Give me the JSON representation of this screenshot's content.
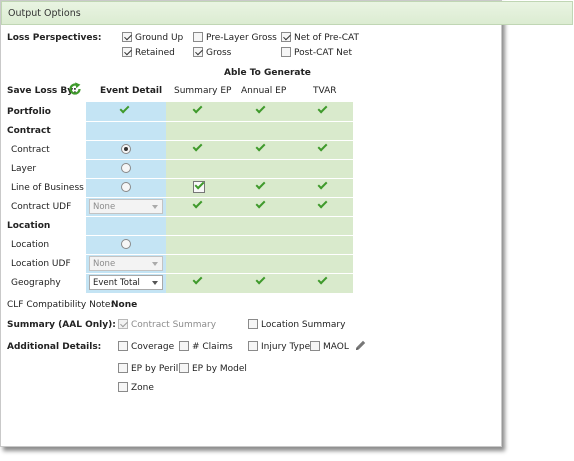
{
  "title": "Output Options",
  "loss_perspectives": {
    "label": "Loss Perspectives:",
    "options": [
      {
        "label": "Ground Up",
        "checked": true
      },
      {
        "label": "Pre-Layer Gross",
        "checked": false
      },
      {
        "label": "Net of Pre-CAT",
        "checked": true
      },
      {
        "label": "Retained",
        "checked": true
      },
      {
        "label": "Gross",
        "checked": true
      },
      {
        "label": "Post-CAT Net",
        "checked": false
      }
    ]
  },
  "able_to_generate": "Able To Generate",
  "save_loss_by": "Save Loss By:",
  "columns": {
    "event_detail": "Event Detail",
    "summary_ep": "Summary EP",
    "annual_ep": "Annual EP",
    "tvar": "TVAR"
  },
  "rows": {
    "portfolio": "Portfolio",
    "contract_header": "Contract",
    "contract": "Contract",
    "layer": "Layer",
    "line_of_business": "Line of Business",
    "contract_udf": "Contract UDF",
    "location_header": "Location",
    "location": "Location",
    "location_udf": "Location UDF",
    "geography": "Geography"
  },
  "combos": {
    "contract_udf": "None",
    "location_udf": "None",
    "geography": "Event Total"
  },
  "clf": {
    "label": "CLF Compatibility Note:",
    "value": "None"
  },
  "summary": {
    "label": "Summary (AAL Only):",
    "contract_summary": "Contract Summary",
    "location_summary": "Location Summary"
  },
  "additional": {
    "label": "Additional Details:",
    "coverage": "Coverage",
    "claims": "# Claims",
    "injury_type": "Injury Type",
    "maol": "MAOL",
    "ep_by_peril": "EP by Peril",
    "ep_by_model": "EP by Model",
    "zone": "Zone"
  },
  "colors": {
    "blue_column": "#c4e4f4",
    "green_columns": "#d9eacc",
    "check": "#3f9a2c",
    "title_bar": "#dcecd2"
  }
}
